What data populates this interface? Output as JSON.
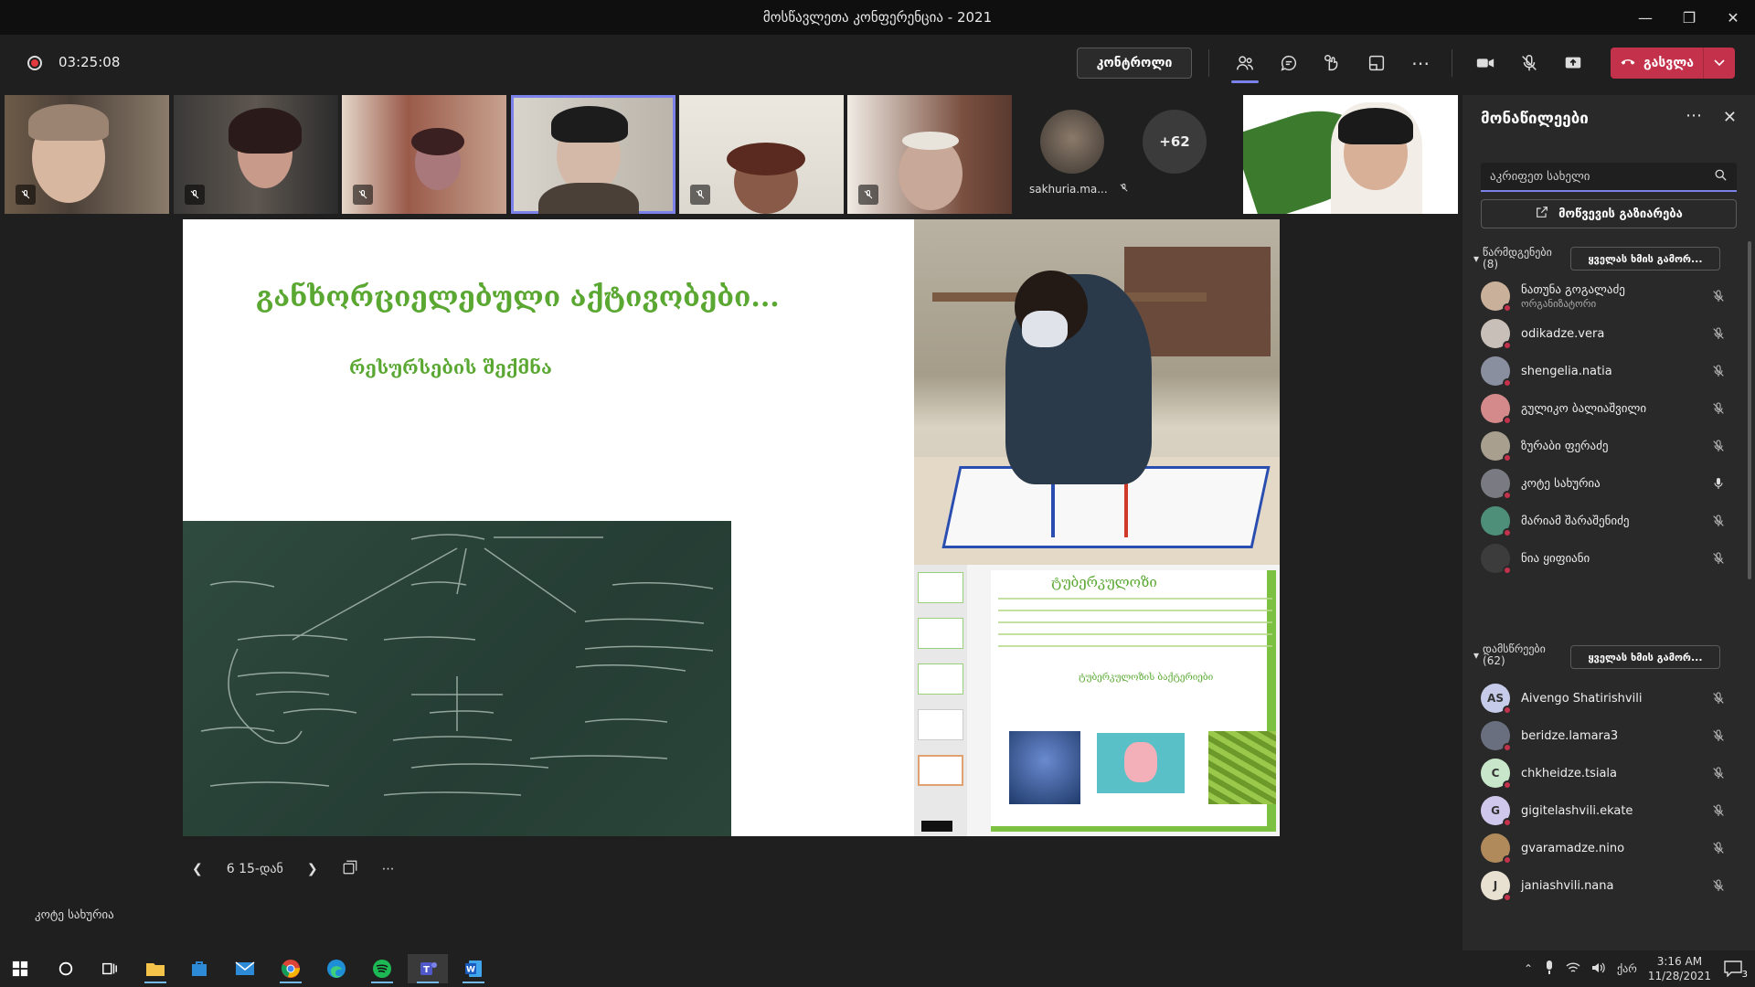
{
  "window": {
    "title": "მოსწავლეთა კონფერენცია - 2021"
  },
  "toolbar": {
    "timer": "03:25:08",
    "control_label": "კონტროლი",
    "leave_label": "გასვლა"
  },
  "video_strip": {
    "named_tile": "sakhuria.ma...",
    "more_count": "+62"
  },
  "slide": {
    "title": "განხორციელებული აქტივობები...",
    "subtitle": "რესურსების შექმნა",
    "page_indicator": "6 15-დან",
    "ppt_heading": "ტუბერკულოზი",
    "ppt_subheading": "ტუბერკულოზის ბაქტერიები"
  },
  "presenter_name": "კოტე სახურია",
  "panel": {
    "title": "მონაწილეები",
    "search_placeholder": "აკრიფეთ სახელი",
    "share_invite": "მოწვევის გაზიარება",
    "presenters": {
      "label": "წარმდგენები",
      "count": "(8)",
      "mute_all": "ყველას ხმის გამორ...",
      "people": [
        {
          "name": "ნათუნა გოგალაძე",
          "role": "ორგანიზატორი",
          "mic": "off",
          "initials": "",
          "bg": "#c9b09a"
        },
        {
          "name": "odikadze.vera",
          "role": "",
          "mic": "off",
          "initials": "",
          "bg": "#c8c0b8"
        },
        {
          "name": "shengelia.natia",
          "role": "",
          "mic": "off",
          "initials": "",
          "bg": "#8a8fa0"
        },
        {
          "name": "გულიკო ბალიაშვილი",
          "role": "",
          "mic": "off",
          "initials": "",
          "bg": "#d48a8a"
        },
        {
          "name": "ზურაბი ფერაძე",
          "role": "",
          "mic": "off",
          "initials": "",
          "bg": "#a89f8e"
        },
        {
          "name": "კოტე სახურია",
          "role": "",
          "mic": "on",
          "initials": "",
          "bg": "#7a7a82"
        },
        {
          "name": "მარიამ შარაშენიძე",
          "role": "",
          "mic": "off",
          "initials": "",
          "bg": "#4e8f7a"
        },
        {
          "name": "ნია ყიფიანი",
          "role": "",
          "mic": "off",
          "initials": "",
          "bg": "#3c3c3c"
        }
      ]
    },
    "attendees": {
      "label": "დამსწრეები",
      "count": "(62)",
      "mute_all": "ყველას ხმის გამორ...",
      "people": [
        {
          "name": "Aivengo Shatirishvili",
          "initials": "AS",
          "bg": "#c5cbe8"
        },
        {
          "name": "beridze.lamara3",
          "initials": "",
          "bg": "#6a6f80"
        },
        {
          "name": "chkheidze.tsiala",
          "initials": "C",
          "bg": "#c8e6c9"
        },
        {
          "name": "gigitelashvili.ekate",
          "initials": "G",
          "bg": "#d0c8ec"
        },
        {
          "name": "gvaramadze.nino",
          "initials": "",
          "bg": "#b08a5a"
        },
        {
          "name": "janiashvili.nana",
          "initials": "J",
          "bg": "#e8e0d0"
        }
      ]
    }
  },
  "taskbar": {
    "time": "3:16 AM",
    "date": "11/28/2021",
    "lang": "ქარ",
    "notif_count": "3"
  },
  "colors": {
    "accent": "#7b83eb",
    "leave": "#c4314b",
    "slide_green": "#5aa832"
  }
}
